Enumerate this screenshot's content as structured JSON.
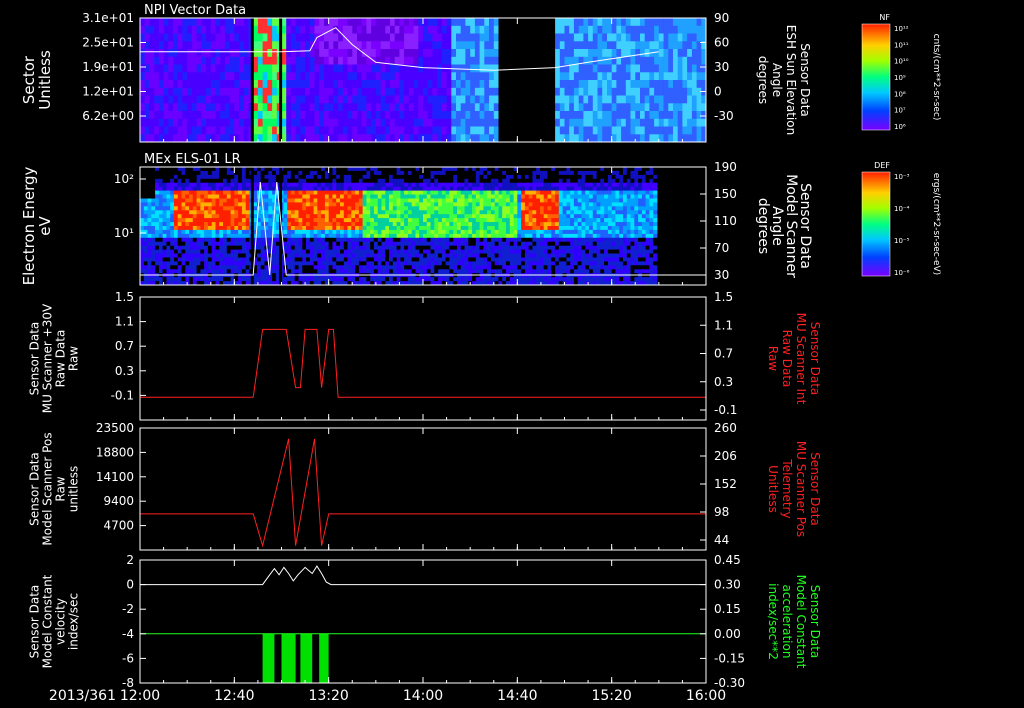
{
  "date_label": "2013/361",
  "x_ticks": [
    "12:00",
    "12:40",
    "13:20",
    "14:00",
    "14:40",
    "15:20",
    "16:00"
  ],
  "chart_data": [
    {
      "type": "heatmap",
      "title": "NPI Vector Data",
      "ylabel": [
        "Sector",
        "Unitless"
      ],
      "yticks": [
        "3.1e+01",
        "2.5e+01",
        "1.9e+01",
        "1.2e+01",
        "6.2e+00"
      ],
      "right_ylabel": [
        "Sensor Data",
        "ESH Sun Elevation",
        "Angle",
        "degrees"
      ],
      "right_ticks": [
        "90",
        "60",
        "30",
        "0",
        "-30"
      ],
      "right_range": [
        -50,
        90
      ],
      "colorbar": {
        "title": "NF",
        "unit": "cnts/(cm**2-sr-sec)",
        "ticks": [
          "10¹²",
          "10¹¹",
          "10¹⁰",
          "10⁹",
          "10⁸",
          "10⁷",
          "10⁶"
        ]
      },
      "overlay_line": {
        "name": "sun_elevation_deg",
        "x_min": [
          60,
          72,
          75,
          83,
          90,
          100,
          120,
          150,
          176,
          190,
          210,
          220
        ],
        "y": [
          52,
          53,
          68,
          79,
          60,
          40,
          34,
          31,
          34,
          40,
          48,
          52
        ]
      }
    },
    {
      "type": "heatmap",
      "title": "MEx ELS-01 LR",
      "ylabel": [
        "Electron Energy",
        "eV"
      ],
      "yticks": [
        "10²",
        "10¹"
      ],
      "right_ylabel": [
        "Sensor Data",
        "Model Scanner",
        "Angle",
        "degrees"
      ],
      "right_ticks": [
        "190",
        "150",
        "110",
        "70",
        "30"
      ],
      "colorbar": {
        "title": "DEF",
        "unit": "ergs/(cm**2-sr-sec-eV)",
        "ticks": [
          "10⁻³",
          "10⁻⁴",
          "10⁻⁵",
          "10⁻⁶"
        ]
      }
    },
    {
      "type": "line",
      "ylabel": [
        "Sensor Data",
        "MU Scanner +30V",
        "Raw Data",
        "Raw"
      ],
      "yticks": [
        "1.5",
        "1.1",
        "0.7",
        "0.3",
        "-0.1"
      ],
      "ylim": [
        -0.4,
        1.5
      ],
      "right_ylabel": [
        "Sensor Data",
        "MU Scanner Int",
        "Raw Data",
        "Raw"
      ],
      "right_ticks": [
        "1.5",
        "1.1",
        "0.7",
        "0.3",
        "-0.1"
      ],
      "series": [
        {
          "x_min": [
            0,
            48,
            52,
            60,
            62,
            66,
            68,
            70,
            73,
            75,
            77,
            80,
            82,
            84,
            240
          ],
          "y": [
            -0.05,
            -0.05,
            1.0,
            1.0,
            1.0,
            0.1,
            0.1,
            1.0,
            1.0,
            1.0,
            0.1,
            1.0,
            1.0,
            -0.05,
            -0.05
          ]
        }
      ]
    },
    {
      "type": "line",
      "ylabel": [
        "Sensor Data",
        "Model Scanner Pos",
        "Raw",
        "unitless"
      ],
      "yticks": [
        "23500",
        "18800",
        "14100",
        "9400",
        "4700"
      ],
      "ylim": [
        1200,
        23500
      ],
      "right_ylabel": [
        "Sensor Data",
        "MU Scanner Pos",
        "Telemetry",
        "Unitless"
      ],
      "right_ticks": [
        "260",
        "206",
        "152",
        "98",
        "44"
      ],
      "series": [
        {
          "x_min": [
            0,
            48,
            52,
            63,
            66,
            74,
            77,
            80,
            240
          ],
          "y": [
            7800,
            7800,
            2000,
            21500,
            2000,
            21500,
            2000,
            7800,
            7800
          ]
        }
      ]
    },
    {
      "type": "line",
      "ylabel": [
        "Sensor Data",
        "Model Constant",
        "velocity",
        "index/sec"
      ],
      "yticks": [
        "2",
        "0",
        "-2",
        "-4",
        "-6",
        "-8"
      ],
      "ylim": [
        -8,
        2
      ],
      "right_ylabel": [
        "Sensor Data",
        "Model Constant",
        "acceleration",
        "index/sec**2"
      ],
      "right_ticks": [
        "0.45",
        "0.30",
        "0.15",
        "0.00",
        "-0.15",
        "-0.30"
      ],
      "series": [
        {
          "name": "velocity",
          "x_min": [
            0,
            52,
            55,
            57,
            59,
            61,
            63,
            65,
            67,
            70,
            73,
            75,
            77,
            79,
            81,
            240
          ],
          "y": [
            0,
            0,
            0.8,
            1.3,
            0.8,
            1.4,
            0.9,
            0.3,
            0.8,
            1.4,
            0.9,
            1.5,
            0.9,
            0.2,
            0,
            0
          ]
        },
        {
          "name": "acceleration",
          "x_min": [
            0,
            240
          ],
          "y": [
            -4,
            -4
          ]
        }
      ]
    }
  ]
}
